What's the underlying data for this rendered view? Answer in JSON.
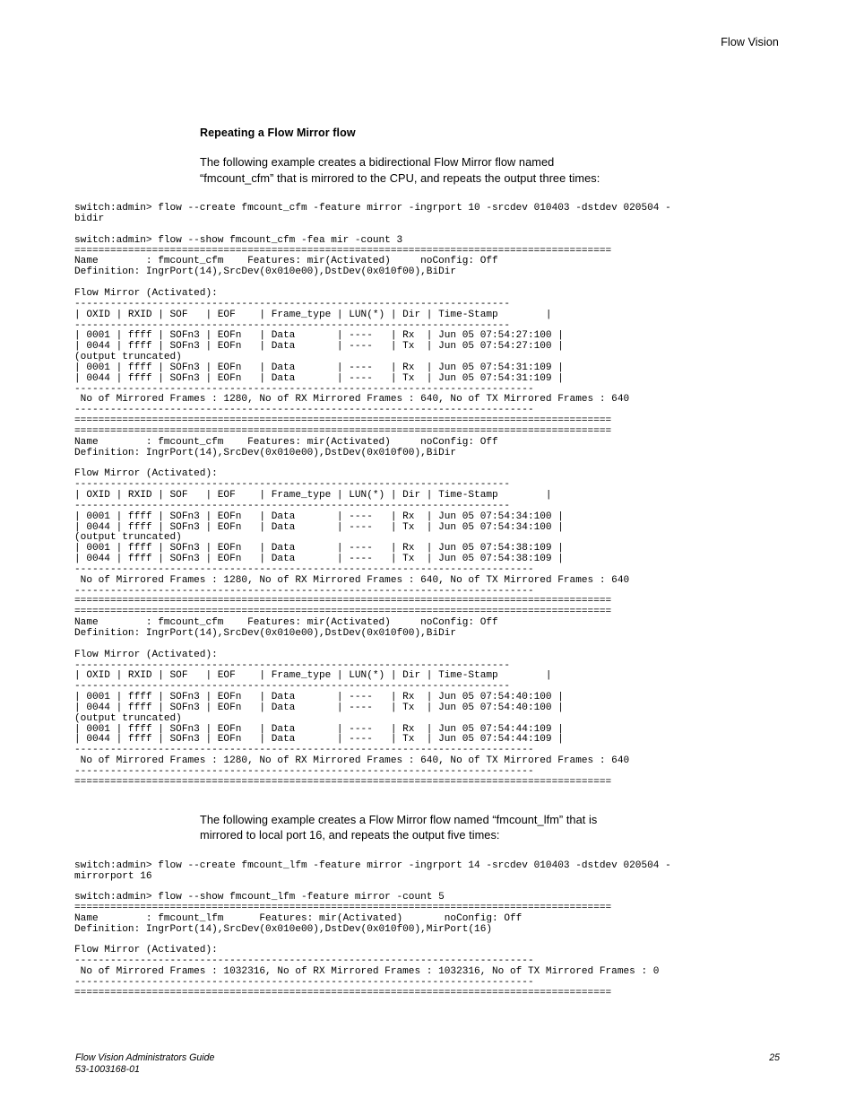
{
  "header": {
    "running_title": "Flow Vision"
  },
  "section": {
    "heading": "Repeating a Flow Mirror flow",
    "paragraph_1": "The following example creates a bidirectional Flow Mirror flow named “fmcount_cfm” that is mirrored to the CPU, and repeats the output three times:",
    "paragraph_2": "The following example creates a Flow Mirror flow named “fmcount_lfm” that is mirrored to local port 16, and repeats the output five times:"
  },
  "cli": {
    "block_1": "switch:admin> flow --create fmcount_cfm -feature mirror -ingrport 10 -srcdev 010403 -dstdev 020504 -\nbidir\n\nswitch:admin> flow --show fmcount_cfm -fea mir -count 3\n==========================================================================================\nName        : fmcount_cfm    Features: mir(Activated)     noConfig: Off\nDefinition: IngrPort(14),SrcDev(0x010e00),DstDev(0x010f00),BiDir\n\nFlow Mirror (Activated):\n-------------------------------------------------------------------------\n| OXID | RXID | SOF   | EOF    | Frame_type | LUN(*) | Dir | Time-Stamp        |\n-------------------------------------------------------------------------\n| 0001 | ffff | SOFn3 | EOFn   | Data       | ----   | Rx  | Jun 05 07:54:27:100 |\n| 0044 | ffff | SOFn3 | EOFn   | Data       | ----   | Tx  | Jun 05 07:54:27:100 |\n(output truncated)\n| 0001 | ffff | SOFn3 | EOFn   | Data       | ----   | Rx  | Jun 05 07:54:31:109 |\n| 0044 | ffff | SOFn3 | EOFn   | Data       | ----   | Tx  | Jun 05 07:54:31:109 |\n-----------------------------------------------------------------------------\n No of Mirrored Frames : 1280, No of RX Mirrored Frames : 640, No of TX Mirrored Frames : 640\n-----------------------------------------------------------------------------\n==========================================================================================\n==========================================================================================\nName        : fmcount_cfm    Features: mir(Activated)     noConfig: Off\nDefinition: IngrPort(14),SrcDev(0x010e00),DstDev(0x010f00),BiDir\n\nFlow Mirror (Activated):\n-------------------------------------------------------------------------\n| OXID | RXID | SOF   | EOF    | Frame_type | LUN(*) | Dir | Time-Stamp        |\n-------------------------------------------------------------------------\n| 0001 | ffff | SOFn3 | EOFn   | Data       | ----   | Rx  | Jun 05 07:54:34:100 |\n| 0044 | ffff | SOFn3 | EOFn   | Data       | ----   | Tx  | Jun 05 07:54:34:100 |\n(output truncated)\n| 0001 | ffff | SOFn3 | EOFn   | Data       | ----   | Rx  | Jun 05 07:54:38:109 |\n| 0044 | ffff | SOFn3 | EOFn   | Data       | ----   | Tx  | Jun 05 07:54:38:109 |\n-----------------------------------------------------------------------------\n No of Mirrored Frames : 1280, No of RX Mirrored Frames : 640, No of TX Mirrored Frames : 640\n-----------------------------------------------------------------------------\n==========================================================================================\n==========================================================================================\nName        : fmcount_cfm    Features: mir(Activated)     noConfig: Off\nDefinition: IngrPort(14),SrcDev(0x010e00),DstDev(0x010f00),BiDir\n\nFlow Mirror (Activated):\n-------------------------------------------------------------------------\n| OXID | RXID | SOF   | EOF    | Frame_type | LUN(*) | Dir | Time-Stamp        |\n-------------------------------------------------------------------------\n| 0001 | ffff | SOFn3 | EOFn   | Data       | ----   | Rx  | Jun 05 07:54:40:100 |\n| 0044 | ffff | SOFn3 | EOFn   | Data       | ----   | Tx  | Jun 05 07:54:40:100 |\n(output truncated)\n| 0001 | ffff | SOFn3 | EOFn   | Data       | ----   | Rx  | Jun 05 07:54:44:109 |\n| 0044 | ffff | SOFn3 | EOFn   | Data       | ----   | Tx  | Jun 05 07:54:44:109 |\n-----------------------------------------------------------------------------\n No of Mirrored Frames : 1280, No of RX Mirrored Frames : 640, No of TX Mirrored Frames : 640\n-----------------------------------------------------------------------------\n==========================================================================================",
    "block_2": "switch:admin> flow --create fmcount_lfm -feature mirror -ingrport 14 -srcdev 010403 -dstdev 020504 -\nmirrorport 16\n\nswitch:admin> flow --show fmcount_lfm -feature mirror -count 5\n==========================================================================================\nName        : fmcount_lfm      Features: mir(Activated)       noConfig: Off\nDefinition: IngrPort(14),SrcDev(0x010e00),DstDev(0x010f00),MirPort(16)\n\nFlow Mirror (Activated):\n-----------------------------------------------------------------------------\n No of Mirrored Frames : 1032316, No of RX Mirrored Frames : 1032316, No of TX Mirrored Frames : 0\n-----------------------------------------------------------------------------\n=========================================================================================="
  },
  "cli_structured": {
    "example_1": {
      "command_create": "flow --create fmcount_cfm -feature mirror -ingrport 10 -srcdev 010403 -dstdev 020504 -bidir",
      "command_show": "flow --show fmcount_cfm -fea mir -count 3",
      "prompt": "switch:admin>",
      "repeat_count": 3,
      "flow_name": "fmcount_cfm",
      "features": "mir(Activated)",
      "noConfig": "Off",
      "definition": "IngrPort(14),SrcDev(0x010e00),DstDev(0x010f00),BiDir",
      "mirror_state": "Flow Mirror (Activated):",
      "table_headers": [
        "OXID",
        "RXID",
        "SOF",
        "EOF",
        "Frame_type",
        "LUN(*)",
        "Dir",
        "Time-Stamp"
      ],
      "iterations": [
        {
          "rows": [
            [
              "0001",
              "ffff",
              "SOFn3",
              "EOFn",
              "Data",
              "----",
              "Rx",
              "Jun 05 07:54:27:100"
            ],
            [
              "0044",
              "ffff",
              "SOFn3",
              "EOFn",
              "Data",
              "----",
              "Tx",
              "Jun 05 07:54:27:100"
            ],
            [
              "0001",
              "ffff",
              "SOFn3",
              "EOFn",
              "Data",
              "----",
              "Rx",
              "Jun 05 07:54:31:109"
            ],
            [
              "0044",
              "ffff",
              "SOFn3",
              "EOFn",
              "Data",
              "----",
              "Tx",
              "Jun 05 07:54:31:109"
            ]
          ],
          "truncation_note": "(output truncated)",
          "total_mirrored_frames": 1280,
          "rx_mirrored_frames": 640,
          "tx_mirrored_frames": 640
        },
        {
          "rows": [
            [
              "0001",
              "ffff",
              "SOFn3",
              "EOFn",
              "Data",
              "----",
              "Rx",
              "Jun 05 07:54:34:100"
            ],
            [
              "0044",
              "ffff",
              "SOFn3",
              "EOFn",
              "Data",
              "----",
              "Tx",
              "Jun 05 07:54:34:100"
            ],
            [
              "0001",
              "ffff",
              "SOFn3",
              "EOFn",
              "Data",
              "----",
              "Rx",
              "Jun 05 07:54:38:109"
            ],
            [
              "0044",
              "ffff",
              "SOFn3",
              "EOFn",
              "Data",
              "----",
              "Tx",
              "Jun 05 07:54:38:109"
            ]
          ],
          "truncation_note": "(output truncated)",
          "total_mirrored_frames": 1280,
          "rx_mirrored_frames": 640,
          "tx_mirrored_frames": 640
        },
        {
          "rows": [
            [
              "0001",
              "ffff",
              "SOFn3",
              "EOFn",
              "Data",
              "----",
              "Rx",
              "Jun 05 07:54:40:100"
            ],
            [
              "0044",
              "ffff",
              "SOFn3",
              "EOFn",
              "Data",
              "----",
              "Tx",
              "Jun 05 07:54:40:100"
            ],
            [
              "0001",
              "ffff",
              "SOFn3",
              "EOFn",
              "Data",
              "----",
              "Rx",
              "Jun 05 07:54:44:109"
            ],
            [
              "0044",
              "ffff",
              "SOFn3",
              "EOFn",
              "Data",
              "----",
              "Tx",
              "Jun 05 07:54:44:109"
            ]
          ],
          "truncation_note": "(output truncated)",
          "total_mirrored_frames": 1280,
          "rx_mirrored_frames": 640,
          "tx_mirrored_frames": 640
        }
      ]
    },
    "example_2": {
      "command_create": "flow --create fmcount_lfm -feature mirror -ingrport 14 -srcdev 010403 -dstdev 020504 -mirrorport 16",
      "command_show": "flow --show fmcount_lfm -feature mirror -count 5",
      "prompt": "switch:admin>",
      "repeat_count": 5,
      "flow_name": "fmcount_lfm",
      "features": "mir(Activated)",
      "noConfig": "Off",
      "definition": "IngrPort(14),SrcDev(0x010e00),DstDev(0x010f00),MirPort(16)",
      "mirror_state": "Flow Mirror (Activated):",
      "total_mirrored_frames": 1032316,
      "rx_mirrored_frames": 1032316,
      "tx_mirrored_frames": 0
    }
  },
  "footer": {
    "guide_title": "Flow Vision Administrators Guide",
    "document_number": "53-1003168-01",
    "page_number": "25"
  }
}
